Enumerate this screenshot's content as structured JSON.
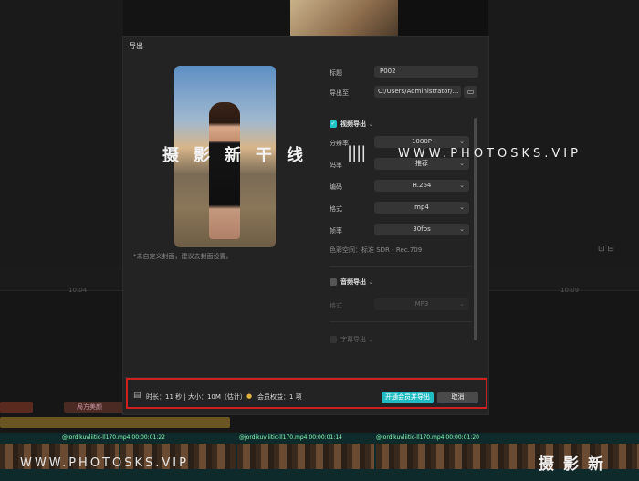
{
  "dialog": {
    "title": "导出",
    "cover_note": "*未自定义封面，建议去封面设置。",
    "fields": {
      "title_label": "标题",
      "title_value": "P002",
      "export_to_label": "导出至",
      "export_to_value": "C:/Users/Administrator/...",
      "folder_icon": "folder-icon"
    },
    "video_section": {
      "label": "视频导出",
      "checked": true,
      "resolution_label": "分辨率",
      "resolution_value": "1080P",
      "bitrate_label": "码率",
      "bitrate_value": "推荐",
      "codec_label": "编码",
      "codec_value": "H.264",
      "format_label": "格式",
      "format_value": "mp4",
      "framerate_label": "帧率",
      "framerate_value": "30fps",
      "color_space_label": "色彩空间：",
      "color_space_value": "标准 SDR - Rec.709"
    },
    "audio_section": {
      "label": "音频导出",
      "checked": false,
      "format_label": "格式",
      "format_value": "MP3"
    },
    "subtitle_section": {
      "label": "字幕导出"
    },
    "footer": {
      "duration_label": "时长：",
      "duration_value": "11 秒",
      "size_label": "大小：",
      "size_value": "10M（估计）",
      "member_label": "会员权益：",
      "member_value": "1 项",
      "export_button": "开通会员并导出",
      "cancel_button": "取消"
    }
  },
  "timeline": {
    "ruler_ticks": [
      "10:04",
      "10:09"
    ],
    "clip_label_effect": "局方美颜",
    "video_clips": [
      {
        "name": "@jordikuvliitic-ll170.mp4",
        "time": "00:00:01:22"
      },
      {
        "name": "@jordikuvliitic-ll170.mp4",
        "time": "00:00:01:14"
      },
      {
        "name": "@jordikuvliitic-ll170.mp4",
        "time": "00:00:01:20"
      }
    ]
  },
  "watermarks": {
    "cn": "摄影新干线",
    "cn_bottom": "摄影新",
    "bars": "||||",
    "url": "WWW.PHOTOSKS.VIP"
  },
  "colors": {
    "accent": "#1fbcc4",
    "highlight_border": "#d01f1f",
    "dialog_bg": "#232323"
  }
}
